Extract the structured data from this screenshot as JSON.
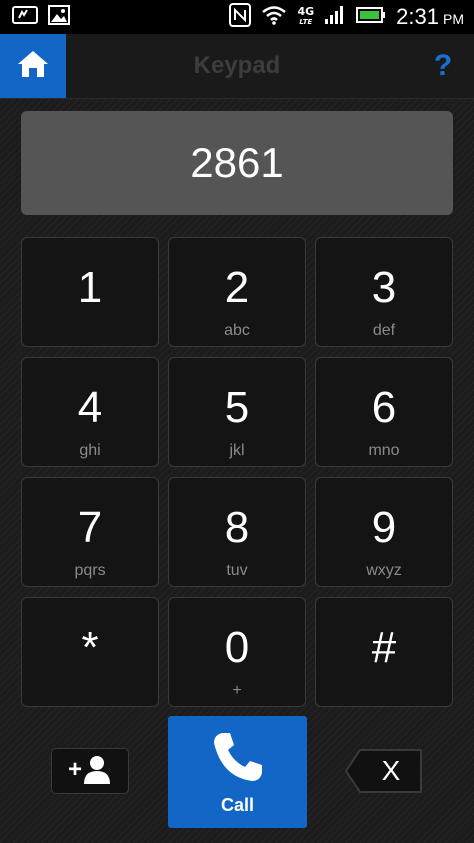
{
  "status_bar": {
    "network": "4G",
    "network_sub": "LTE",
    "time": "2:31",
    "ampm": "PM"
  },
  "app_bar": {
    "title": "Keypad",
    "help": "?"
  },
  "display": {
    "number": "2861"
  },
  "keypad": {
    "keys": [
      {
        "digit": "1",
        "letters": ""
      },
      {
        "digit": "2",
        "letters": "abc"
      },
      {
        "digit": "3",
        "letters": "def"
      },
      {
        "digit": "4",
        "letters": "ghi"
      },
      {
        "digit": "5",
        "letters": "jkl"
      },
      {
        "digit": "6",
        "letters": "mno"
      },
      {
        "digit": "7",
        "letters": "pqrs"
      },
      {
        "digit": "8",
        "letters": "tuv"
      },
      {
        "digit": "9",
        "letters": "wxyz"
      },
      {
        "digit": "*",
        "letters": ""
      },
      {
        "digit": "0",
        "letters": "+"
      },
      {
        "digit": "#",
        "letters": ""
      }
    ]
  },
  "actions": {
    "add_contact_plus": "+",
    "call_label": "Call",
    "backspace_label": "X"
  },
  "colors": {
    "accent": "#1266c6",
    "background": "#1c1c1c",
    "display_bg": "#555555"
  }
}
